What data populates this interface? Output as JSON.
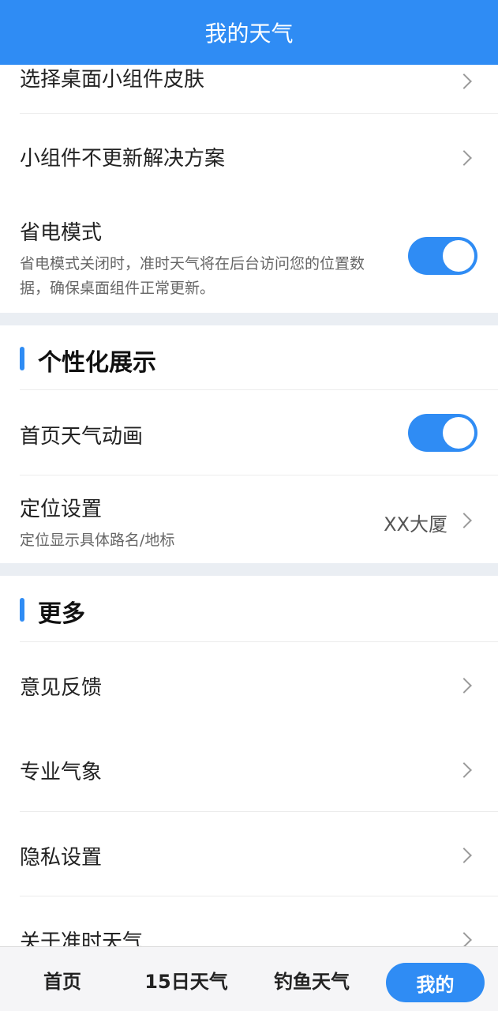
{
  "header": {
    "title": "我的天气"
  },
  "settings": {
    "skin": {
      "label": "选择桌面小组件皮肤"
    },
    "widget_fix": {
      "label": "小组件不更新解决方案"
    },
    "power_save": {
      "label": "省电模式",
      "desc_line1": "省电模式关闭时，准时天气将在后台访问您的位置数",
      "desc_line2": "据，确保桌面组件正常更新。",
      "enabled": true
    }
  },
  "personal": {
    "title": "个性化展示",
    "animation": {
      "label": "首页天气动画",
      "enabled": true
    },
    "location": {
      "label": "定位设置",
      "desc": "定位显示具体路名/地标",
      "value": "XX大厦"
    }
  },
  "more": {
    "title": "更多",
    "items": [
      {
        "label": "意见反馈"
      },
      {
        "label": "专业气象"
      },
      {
        "label": "隐私设置"
      },
      {
        "label": "关于准时天气"
      }
    ]
  },
  "tabbar": {
    "tabs": [
      {
        "label": "首页"
      },
      {
        "label": "15日天气"
      },
      {
        "label": "钓鱼天气"
      },
      {
        "label": "我的",
        "active": true
      }
    ]
  },
  "colors": {
    "accent": "#2f8cf4",
    "section_gap": "#eaeef3"
  }
}
